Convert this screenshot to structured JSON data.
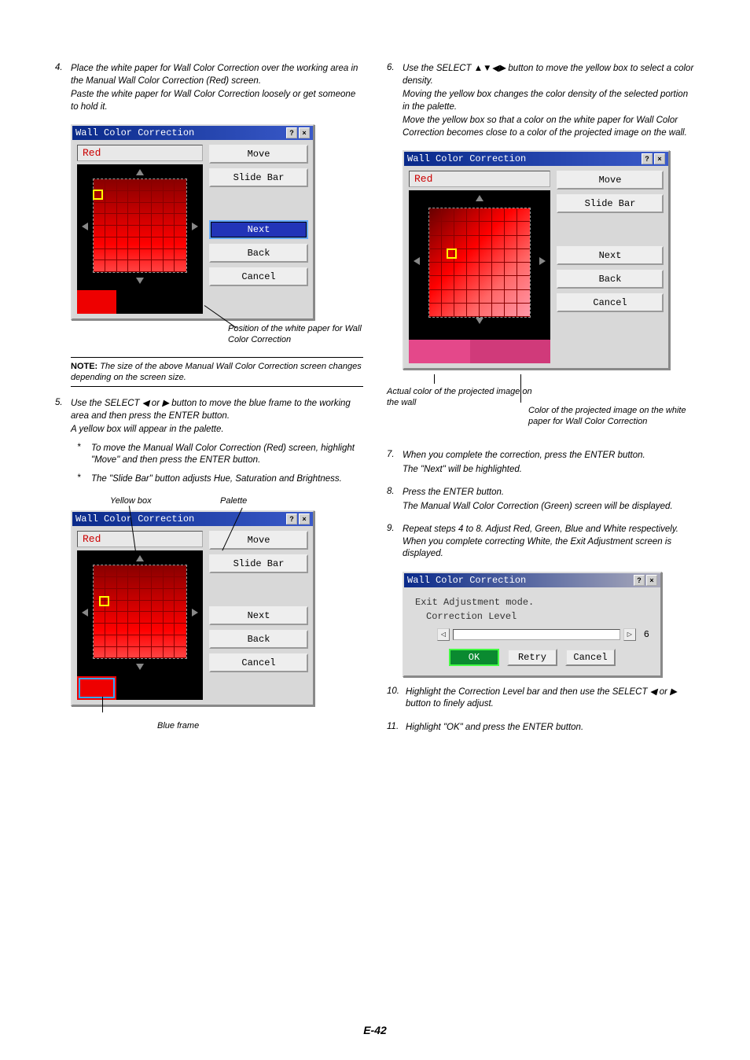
{
  "left": {
    "step4": {
      "num": "4.",
      "text": "Place the white paper for Wall Color Correction over the working area in the Manual Wall Color Correction (Red) screen.",
      "sub": "Paste the white paper for Wall Color Correction loosely or get someone to hold it."
    },
    "fig1": {
      "title": "Wall Color Correction",
      "red": "Red",
      "buttons": [
        "Move",
        "Slide Bar",
        "Next",
        "Back",
        "Cancel"
      ],
      "selectedIndex": 2,
      "caption": "Position of the white paper for Wall Color Correction"
    },
    "note": {
      "label": "NOTE:",
      "text": " The size of the above Manual Wall Color Correction screen changes depending on the screen size."
    },
    "step5": {
      "num": "5.",
      "text": "Use the SELECT ◀ or ▶ button to move the blue frame to the working area and then press the ENTER button.",
      "sub": "A yellow box will appear in the palette.",
      "bullets": [
        "To move the Manual Wall Color Correction (Red) screen, highlight \"Move\" and then press the ENTER button.",
        "The \"Slide Bar\" button adjusts Hue, Saturation and Brightness."
      ]
    },
    "fig2": {
      "title": "Wall Color Correction",
      "red": "Red",
      "annot_yellow": "Yellow box",
      "annot_palette": "Palette",
      "annot_blueframe": "Blue frame",
      "buttons": [
        "Move",
        "Slide Bar",
        "Next",
        "Back",
        "Cancel"
      ]
    }
  },
  "right": {
    "step6": {
      "num": "6.",
      "text": "Use the SELECT ▲▼◀▶ button to move the yellow box to select a color density.",
      "sub1": "Moving the yellow box changes the color density of the selected portion in the palette.",
      "sub2": "Move the yellow box so that a color on the white paper for Wall Color Correction becomes close to a color of the projected image on the wall."
    },
    "fig3": {
      "title": "Wall Color Correction",
      "red": "Red",
      "buttons": [
        "Move",
        "Slide Bar",
        "Next",
        "Back",
        "Cancel"
      ],
      "caption_left": "Actual color of the projected image on the wall",
      "caption_right": "Color of the projected image on the white paper for Wall Color Correction"
    },
    "step7": {
      "num": "7.",
      "text": "When you complete the correction, press the ENTER button.",
      "sub": "The \"Next\" will be highlighted."
    },
    "step8": {
      "num": "8.",
      "text": "Press the ENTER button.",
      "sub": "The Manual Wall Color Correction (Green) screen will be displayed."
    },
    "step9": {
      "num": "9.",
      "text": "Repeat steps 4 to 8. Adjust Red, Green, Blue and White respectively. When you complete correcting White, the Exit Adjustment screen is displayed."
    },
    "exitDlg": {
      "title": "Wall Color Correction",
      "line1": "Exit Adjustment mode.",
      "line2": "Correction Level",
      "value": "6",
      "ok": "OK",
      "retry": "Retry",
      "cancel": "Cancel"
    },
    "step10": {
      "num": "10.",
      "text": "Highlight the Correction Level bar and then use the SELECT ◀ or ▶ button to finely adjust."
    },
    "step11": {
      "num": "11.",
      "text": "Highlight \"OK\" and press the ENTER button."
    }
  },
  "pageNum": "E-42"
}
